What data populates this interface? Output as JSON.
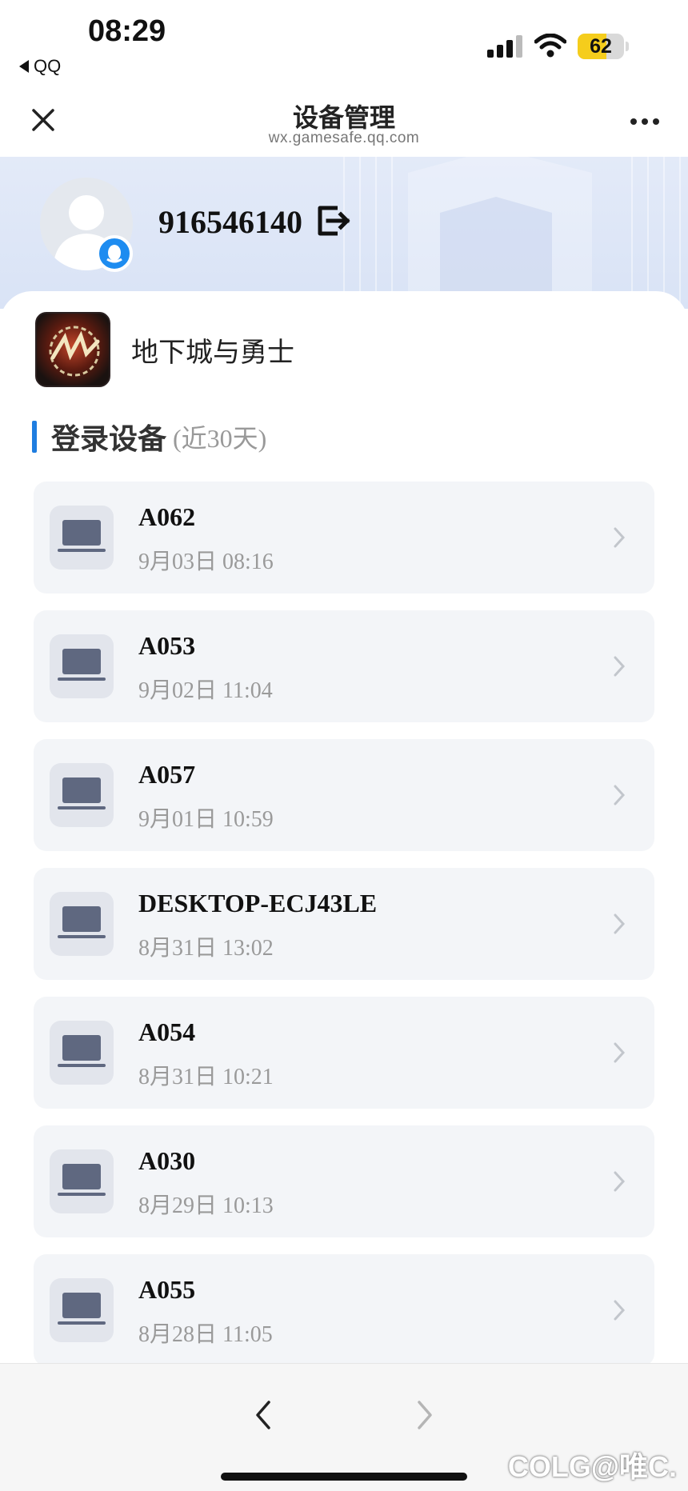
{
  "status_bar": {
    "time": "08:29",
    "back_app": "QQ",
    "battery_percent": 62
  },
  "nav": {
    "title": "设备管理",
    "subtitle": "wx.gamesafe.qq.com"
  },
  "account": {
    "id": "916546140"
  },
  "game": {
    "name": "地下城与勇士"
  },
  "section": {
    "title": "登录设备",
    "subtitle": "(近30天)"
  },
  "devices": [
    {
      "name": "A062",
      "time": "9月03日 08:16"
    },
    {
      "name": "A053",
      "time": "9月02日 11:04"
    },
    {
      "name": "A057",
      "time": "9月01日 10:59"
    },
    {
      "name": "DESKTOP-ECJ43LE",
      "time": "8月31日 13:02"
    },
    {
      "name": "A054",
      "time": "8月31日 10:21"
    },
    {
      "name": "A030",
      "time": "8月29日 10:13"
    },
    {
      "name": "A055",
      "time": "8月28日 11:05"
    }
  ],
  "watermark": "COLG@唯C.",
  "colors": {
    "accent": "#1f7de0",
    "battery": "#f5cd1c",
    "card_bg": "#f3f5f8",
    "banner_bg": "#e3eaf8"
  },
  "icons": [
    "close-icon",
    "more-icon",
    "logout-icon",
    "laptop-icon",
    "chevron-right-icon",
    "back-arrow-icon",
    "forward-arrow-icon",
    "qq-badge-icon",
    "signal-icon",
    "wifi-icon",
    "battery-icon"
  ]
}
